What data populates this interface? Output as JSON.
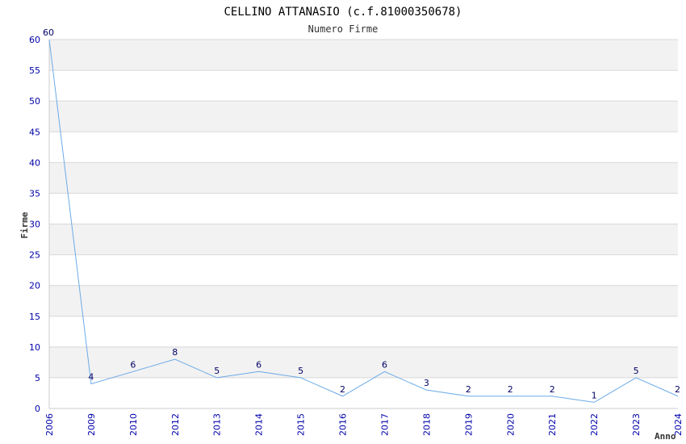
{
  "chart_data": {
    "type": "line",
    "title": "CELLINO ATTANASIO (c.f.81000350678)",
    "subtitle": "Numero Firme",
    "xlabel": "Anno",
    "ylabel": "Firme",
    "categories": [
      "2006",
      "2009",
      "2010",
      "2012",
      "2013",
      "2014",
      "2015",
      "2016",
      "2017",
      "2018",
      "2019",
      "2020",
      "2021",
      "2022",
      "2023",
      "2024"
    ],
    "series": [
      {
        "values": [
          60,
          4,
          6,
          8,
          5,
          6,
          5,
          2,
          6,
          3,
          2,
          2,
          2,
          1,
          5,
          2
        ]
      }
    ],
    "ylim": [
      0,
      60
    ],
    "yticks": [
      0,
      5,
      10,
      15,
      20,
      25,
      30,
      35,
      40,
      45,
      50,
      55,
      60
    ],
    "grid": true,
    "colors": {
      "line": "#6aaae8",
      "band": "#f2f2f2",
      "gridline": "#d8d8d8",
      "tick_text": "#0000aa"
    }
  }
}
